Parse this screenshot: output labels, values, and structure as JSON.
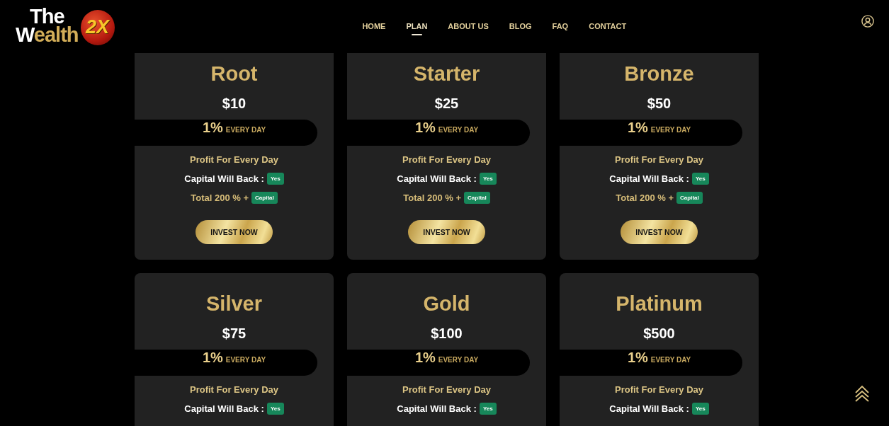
{
  "header": {
    "logo": {
      "line_1": "The",
      "line_2": "Wealth",
      "badge": "2X"
    },
    "nav": [
      {
        "label": "HOME",
        "selected": false
      },
      {
        "label": "PLAN",
        "selected": true
      },
      {
        "label": "ABOUT US",
        "selected": false
      },
      {
        "label": "BLOG",
        "selected": false
      },
      {
        "label": "FAQ",
        "selected": false
      },
      {
        "label": "CONTACT",
        "selected": false
      }
    ]
  },
  "plans": [
    {
      "name": "Root",
      "price": "$10",
      "rate": "1%",
      "rate_label": "EVERY DAY",
      "features": [
        {
          "kind": "profit",
          "text": "Profit For Every Day"
        },
        {
          "kind": "capital",
          "text": "Capital Will Back :",
          "tag": "Yes"
        },
        {
          "kind": "total",
          "text": "Total 200 % +",
          "tag": "Capital"
        }
      ],
      "button": "INVEST NOW"
    },
    {
      "name": "Starter",
      "price": "$25",
      "rate": "1%",
      "rate_label": "EVERY DAY",
      "features": [
        {
          "kind": "profit",
          "text": "Profit For Every Day"
        },
        {
          "kind": "capital",
          "text": "Capital Will Back :",
          "tag": "Yes"
        },
        {
          "kind": "total",
          "text": "Total 200 % +",
          "tag": "Capital"
        }
      ],
      "button": "INVEST NOW"
    },
    {
      "name": "Bronze",
      "price": "$50",
      "rate": "1%",
      "rate_label": "EVERY DAY",
      "features": [
        {
          "kind": "profit",
          "text": "Profit For Every Day"
        },
        {
          "kind": "capital",
          "text": "Capital Will Back :",
          "tag": "Yes"
        },
        {
          "kind": "total",
          "text": "Total 200 % +",
          "tag": "Capital"
        }
      ],
      "button": "INVEST NOW"
    },
    {
      "name": "Silver",
      "price": "$75",
      "rate": "1%",
      "rate_label": "EVERY DAY",
      "features": [
        {
          "kind": "profit",
          "text": "Profit For Every Day"
        },
        {
          "kind": "capital",
          "text": "Capital Will Back :",
          "tag": "Yes"
        }
      ]
    },
    {
      "name": "Gold",
      "price": "$100",
      "rate": "1%",
      "rate_label": "EVERY DAY",
      "features": [
        {
          "kind": "profit",
          "text": "Profit For Every Day"
        },
        {
          "kind": "capital",
          "text": "Capital Will Back :",
          "tag": "Yes"
        }
      ]
    },
    {
      "name": "Platinum",
      "price": "$500",
      "rate": "1%",
      "rate_label": "EVERY DAY",
      "features": [
        {
          "kind": "profit",
          "text": "Profit For Every Day"
        },
        {
          "kind": "capital",
          "text": "Capital Will Back :",
          "tag": "Yes"
        }
      ]
    }
  ]
}
